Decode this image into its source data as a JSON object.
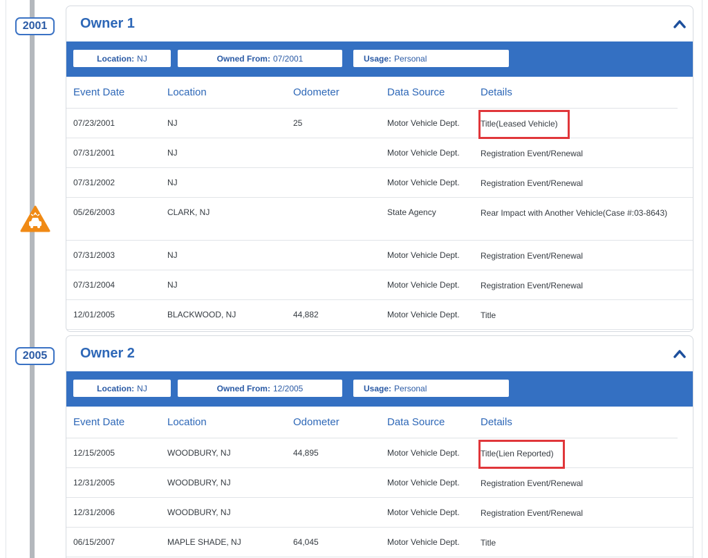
{
  "colors": {
    "accent_blue": "#3470c2",
    "title_blue": "#2d67b7",
    "timeline_gray": "#b4b8bd",
    "accident_orange": "#f08a15",
    "highlight_red": "#e0363a"
  },
  "timeline": {
    "year_badges": [
      "2001",
      "2005"
    ],
    "accident_icon": "car-crash-icon"
  },
  "columns": [
    "Event Date",
    "Location",
    "Odometer",
    "Data Source",
    "Details"
  ],
  "owners": [
    {
      "title": "Owner 1",
      "collapse_icon": "chevron-up-icon",
      "summary": {
        "location_label": "Location:",
        "location_value": "NJ",
        "owned_from_label": "Owned From:",
        "owned_from_value": "07/2001",
        "usage_label": "Usage:",
        "usage_value": "Personal"
      },
      "rows": [
        {
          "date": "07/23/2001",
          "location": "NJ",
          "odometer": "25",
          "source": "Motor Vehicle Dept.",
          "details": "Title(Leased Vehicle)"
        },
        {
          "date": "07/31/2001",
          "location": "NJ",
          "odometer": "",
          "source": "Motor Vehicle Dept.",
          "details": "Registration Event/Renewal"
        },
        {
          "date": "07/31/2002",
          "location": "NJ",
          "odometer": "",
          "source": "Motor Vehicle Dept.",
          "details": "Registration Event/Renewal"
        },
        {
          "date": "05/26/2003",
          "location": "CLARK, NJ",
          "odometer": "",
          "source": "State Agency",
          "details": "Rear Impact with Another Vehicle(Case #:03-8643)"
        },
        {
          "date": "07/31/2003",
          "location": "NJ",
          "odometer": "",
          "source": "Motor Vehicle Dept.",
          "details": "Registration Event/Renewal"
        },
        {
          "date": "07/31/2004",
          "location": "NJ",
          "odometer": "",
          "source": "Motor Vehicle Dept.",
          "details": "Registration Event/Renewal"
        },
        {
          "date": "12/01/2005",
          "location": "BLACKWOOD, NJ",
          "odometer": "44,882",
          "source": "Motor Vehicle Dept.",
          "details": "Title"
        }
      ]
    },
    {
      "title": "Owner 2",
      "collapse_icon": "chevron-up-icon",
      "summary": {
        "location_label": "Location:",
        "location_value": "NJ",
        "owned_from_label": "Owned From:",
        "owned_from_value": "12/2005",
        "usage_label": "Usage:",
        "usage_value": "Personal"
      },
      "rows": [
        {
          "date": "12/15/2005",
          "location": "WOODBURY, NJ",
          "odometer": "44,895",
          "source": "Motor Vehicle Dept.",
          "details": "Title(Lien Reported)"
        },
        {
          "date": "12/31/2005",
          "location": "WOODBURY, NJ",
          "odometer": "",
          "source": "Motor Vehicle Dept.",
          "details": "Registration Event/Renewal"
        },
        {
          "date": "12/31/2006",
          "location": "WOODBURY, NJ",
          "odometer": "",
          "source": "Motor Vehicle Dept.",
          "details": "Registration Event/Renewal"
        },
        {
          "date": "06/15/2007",
          "location": "MAPLE SHADE, NJ",
          "odometer": "64,045",
          "source": "Motor Vehicle Dept.",
          "details": "Title"
        }
      ]
    }
  ]
}
